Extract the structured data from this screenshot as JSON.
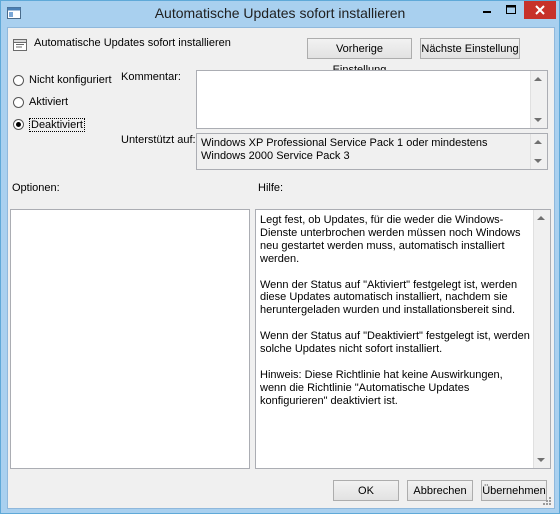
{
  "window": {
    "title": "Automatische Updates sofort installieren"
  },
  "policy": {
    "title": "Automatische Updates sofort installieren"
  },
  "nav": {
    "prev_label": "Vorherige Einstellung",
    "next_label": "Nächste Einstellung"
  },
  "state": {
    "options": [
      {
        "label": "Nicht konfiguriert",
        "selected": false
      },
      {
        "label": "Aktiviert",
        "selected": false
      },
      {
        "label": "Deaktiviert",
        "selected": true
      }
    ]
  },
  "comment": {
    "label": "Kommentar:",
    "value": ""
  },
  "supported": {
    "label": "Unterstützt auf:",
    "value": "Windows XP Professional Service Pack 1 oder mindestens Windows 2000 Service Pack 3"
  },
  "options_panel": {
    "label": "Optionen:"
  },
  "help": {
    "label": "Hilfe:",
    "paragraphs": [
      "Legt fest, ob Updates, für die weder die Windows-Dienste unterbrochen werden müssen noch Windows neu gestartet werden muss, automatisch installiert werden.",
      "Wenn der Status auf \"Aktiviert\" festgelegt ist, werden diese Updates automatisch installiert, nachdem sie heruntergeladen wurden und installationsbereit sind.",
      "Wenn der Status auf \"Deaktiviert\" festgelegt ist, werden solche Updates nicht sofort installiert.",
      "Hinweis: Diese Richtlinie hat keine Auswirkungen, wenn die Richtlinie \"Automatische Updates konfigurieren\" deaktiviert ist."
    ]
  },
  "footer": {
    "ok_label": "OK",
    "cancel_label": "Abbrechen",
    "apply_label": "Übernehmen"
  },
  "colors": {
    "frame": "#a9d0ef",
    "close_button": "#c7312a",
    "dialog_bg": "#f0f0f0"
  },
  "icons": [
    "policy-app-icon",
    "minimize-icon",
    "maximize-icon",
    "close-icon",
    "policy-setting-icon",
    "scroll-up-icon",
    "scroll-down-icon",
    "resize-grip-icon"
  ]
}
